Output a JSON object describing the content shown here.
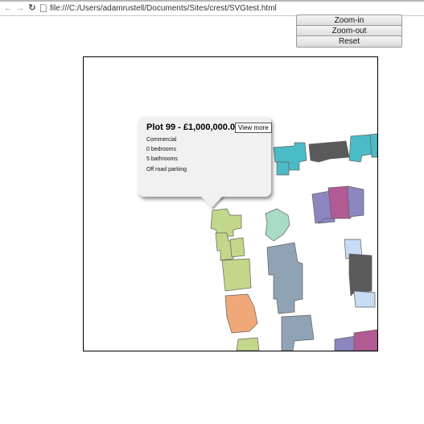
{
  "browser": {
    "back_icon": "arrow-left-icon",
    "forward_icon": "arrow-right-icon",
    "reload_icon": "reload-icon",
    "page_icon": "page-icon",
    "url": "file:///C:/Users/adamrustell/Documents/Sites/crest/SVGtest.html"
  },
  "controls": {
    "zoom_in": "Zoom-in",
    "zoom_out": "Zoom-out",
    "reset": "Reset"
  },
  "popup": {
    "title": "Plot 99 - £1,000,000.00",
    "view_more": "View more",
    "type": "Commercial",
    "bedrooms": "0 bedrooms",
    "bathrooms": "5 bathrooms",
    "parking": "Off road parking"
  },
  "colors": {
    "teal": "#4bbcc6",
    "dark_gray": "#5a5a5a",
    "lime": "#c3d78a",
    "mint": "#a8dcc4",
    "slate_blue": "#8fa3b4",
    "purple": "#8c86c0",
    "magenta": "#b25a94",
    "orange": "#f0a878",
    "light_blue": "#c8dcf4"
  }
}
